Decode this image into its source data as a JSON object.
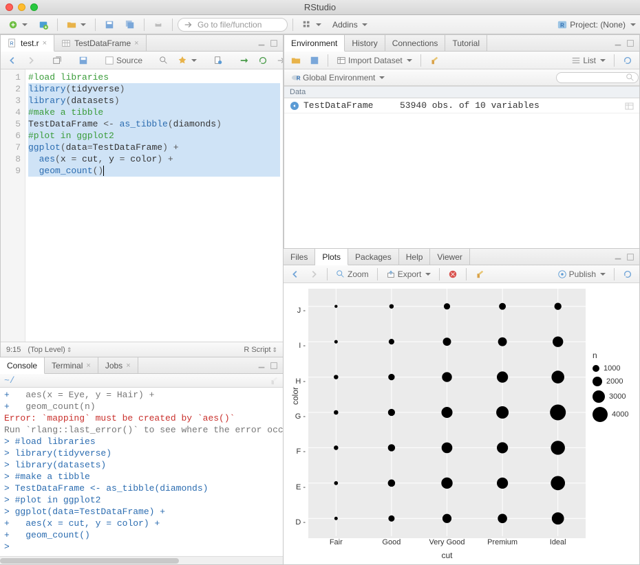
{
  "window": {
    "title": "RStudio"
  },
  "main_toolbar": {
    "goto_placeholder": "Go to file/function",
    "addins_label": "Addins",
    "project_label": "Project: (None)"
  },
  "source": {
    "tabs": [
      {
        "label": "test.r",
        "icon": "r-file-icon"
      },
      {
        "label": "TestDataFrame",
        "icon": "table-icon"
      }
    ],
    "subtoolbar": {
      "source_label": "Source"
    },
    "code_lines": [
      {
        "n": 1,
        "seg": [
          [
            "#load libraries",
            "comment"
          ]
        ],
        "hl": false
      },
      {
        "n": 2,
        "seg": [
          [
            "library",
            "fn"
          ],
          [
            "(",
            "op"
          ],
          [
            "tidyverse",
            "plain"
          ],
          [
            ")",
            "op"
          ]
        ],
        "hl": true
      },
      {
        "n": 3,
        "seg": [
          [
            "library",
            "fn"
          ],
          [
            "(",
            "op"
          ],
          [
            "datasets",
            "plain"
          ],
          [
            ")",
            "op"
          ]
        ],
        "hl": true
      },
      {
        "n": 4,
        "seg": [
          [
            "#make a tibble",
            "comment"
          ]
        ],
        "hl": true
      },
      {
        "n": 5,
        "seg": [
          [
            "TestDataFrame ",
            "plain"
          ],
          [
            "<- ",
            "op"
          ],
          [
            "as_tibble",
            "fn"
          ],
          [
            "(",
            "op"
          ],
          [
            "diamonds",
            "plain"
          ],
          [
            ")",
            "op"
          ]
        ],
        "hl": true
      },
      {
        "n": 6,
        "seg": [
          [
            "#plot in ggplot2",
            "comment"
          ]
        ],
        "hl": true
      },
      {
        "n": 7,
        "seg": [
          [
            "ggplot",
            "fn"
          ],
          [
            "(",
            "op"
          ],
          [
            "data",
            "plain"
          ],
          [
            "=",
            "op"
          ],
          [
            "TestDataFrame",
            "plain"
          ],
          [
            ") ",
            "op"
          ],
          [
            "+",
            "op"
          ]
        ],
        "hl": true
      },
      {
        "n": 8,
        "seg": [
          [
            "  ",
            "plain"
          ],
          [
            "aes",
            "fn"
          ],
          [
            "(",
            "op"
          ],
          [
            "x ",
            "plain"
          ],
          [
            "= ",
            "op"
          ],
          [
            "cut",
            "plain"
          ],
          [
            ", ",
            "op"
          ],
          [
            "y ",
            "plain"
          ],
          [
            "= ",
            "op"
          ],
          [
            "color",
            "plain"
          ],
          [
            ") ",
            "op"
          ],
          [
            "+",
            "op"
          ]
        ],
        "hl": true
      },
      {
        "n": 9,
        "seg": [
          [
            "  ",
            "plain"
          ],
          [
            "geom_count",
            "fn"
          ],
          [
            "()",
            "op"
          ]
        ],
        "hl": true
      }
    ],
    "status": {
      "pos": "9:15",
      "scope": "(Top Level)",
      "lang": "R Script"
    }
  },
  "env": {
    "tabs": [
      "Environment",
      "History",
      "Connections",
      "Tutorial"
    ],
    "toolbar": {
      "import_label": "Import Dataset",
      "scope_label": "Global Environment",
      "view_label": "List"
    },
    "section": "Data",
    "rows": [
      {
        "name": "TestDataFrame",
        "val": "53940 obs. of 10 variables"
      }
    ]
  },
  "console": {
    "tabs": [
      "Console",
      "Terminal",
      "Jobs"
    ],
    "path": "~/",
    "lines": [
      {
        "cls": "grey",
        "pre": "+",
        "text": "   aes(x = Eye, y = Hair) +"
      },
      {
        "cls": "grey",
        "pre": "+",
        "text": "   geom_count(n)"
      },
      {
        "cls": "red",
        "pre": "",
        "text": "Error: `mapping` must be created by `aes()`"
      },
      {
        "cls": "grey",
        "pre": "",
        "text": "Run `rlang::last_error()` to see where the error occ"
      },
      {
        "cls": "blue",
        "pre": ">",
        "text": " #load libraries"
      },
      {
        "cls": "blue",
        "pre": ">",
        "text": " library(tidyverse)"
      },
      {
        "cls": "blue",
        "pre": ">",
        "text": " library(datasets)"
      },
      {
        "cls": "blue",
        "pre": ">",
        "text": " #make a tibble"
      },
      {
        "cls": "blue",
        "pre": ">",
        "text": " TestDataFrame <- as_tibble(diamonds)"
      },
      {
        "cls": "blue",
        "pre": ">",
        "text": " #plot in ggplot2"
      },
      {
        "cls": "blue",
        "pre": ">",
        "text": " ggplot(data=TestDataFrame) +"
      },
      {
        "cls": "blue",
        "pre": "+",
        "text": "   aes(x = cut, y = color) +"
      },
      {
        "cls": "blue",
        "pre": "+",
        "text": "   geom_count()"
      },
      {
        "cls": "blue",
        "pre": ">",
        "text": " "
      }
    ]
  },
  "plots": {
    "tabs": [
      "Files",
      "Plots",
      "Packages",
      "Help",
      "Viewer"
    ],
    "toolbar": {
      "zoom": "Zoom",
      "export": "Export",
      "publish": "Publish"
    },
    "ylabel": "color",
    "xlabel": "cut",
    "legend_title": "n",
    "legend_items": [
      {
        "label": "1000",
        "r": 5
      },
      {
        "label": "2000",
        "r": 7
      },
      {
        "label": "3000",
        "r": 9
      },
      {
        "label": "4000",
        "r": 11
      }
    ]
  },
  "chart_data": {
    "type": "scatter",
    "title": "",
    "xlabel": "cut",
    "ylabel": "color",
    "x_categories": [
      "Fair",
      "Good",
      "Very Good",
      "Premium",
      "Ideal"
    ],
    "y_categories": [
      "D",
      "E",
      "F",
      "G",
      "H",
      "I",
      "J"
    ],
    "size_legend": {
      "title": "n",
      "breaks": [
        1000,
        2000,
        3000,
        4000
      ]
    },
    "points": [
      {
        "x": "Fair",
        "y": "D",
        "n": 163
      },
      {
        "x": "Good",
        "y": "D",
        "n": 662
      },
      {
        "x": "Very Good",
        "y": "D",
        "n": 1513
      },
      {
        "x": "Premium",
        "y": "D",
        "n": 1603
      },
      {
        "x": "Ideal",
        "y": "D",
        "n": 2834
      },
      {
        "x": "Fair",
        "y": "E",
        "n": 224
      },
      {
        "x": "Good",
        "y": "E",
        "n": 933
      },
      {
        "x": "Very Good",
        "y": "E",
        "n": 2400
      },
      {
        "x": "Premium",
        "y": "E",
        "n": 2337
      },
      {
        "x": "Ideal",
        "y": "E",
        "n": 3903
      },
      {
        "x": "Fair",
        "y": "F",
        "n": 312
      },
      {
        "x": "Good",
        "y": "F",
        "n": 909
      },
      {
        "x": "Very Good",
        "y": "F",
        "n": 2164
      },
      {
        "x": "Premium",
        "y": "F",
        "n": 2331
      },
      {
        "x": "Ideal",
        "y": "F",
        "n": 3826
      },
      {
        "x": "Fair",
        "y": "G",
        "n": 314
      },
      {
        "x": "Good",
        "y": "G",
        "n": 871
      },
      {
        "x": "Very Good",
        "y": "G",
        "n": 2299
      },
      {
        "x": "Premium",
        "y": "G",
        "n": 2924
      },
      {
        "x": "Ideal",
        "y": "G",
        "n": 4884
      },
      {
        "x": "Fair",
        "y": "H",
        "n": 303
      },
      {
        "x": "Good",
        "y": "H",
        "n": 702
      },
      {
        "x": "Very Good",
        "y": "H",
        "n": 1824
      },
      {
        "x": "Premium",
        "y": "H",
        "n": 2360
      },
      {
        "x": "Ideal",
        "y": "H",
        "n": 3115
      },
      {
        "x": "Fair",
        "y": "I",
        "n": 175
      },
      {
        "x": "Good",
        "y": "I",
        "n": 522
      },
      {
        "x": "Very Good",
        "y": "I",
        "n": 1204
      },
      {
        "x": "Premium",
        "y": "I",
        "n": 1428
      },
      {
        "x": "Ideal",
        "y": "I",
        "n": 2093
      },
      {
        "x": "Fair",
        "y": "J",
        "n": 119
      },
      {
        "x": "Good",
        "y": "J",
        "n": 307
      },
      {
        "x": "Very Good",
        "y": "J",
        "n": 678
      },
      {
        "x": "Premium",
        "y": "J",
        "n": 808
      },
      {
        "x": "Ideal",
        "y": "J",
        "n": 896
      }
    ]
  }
}
